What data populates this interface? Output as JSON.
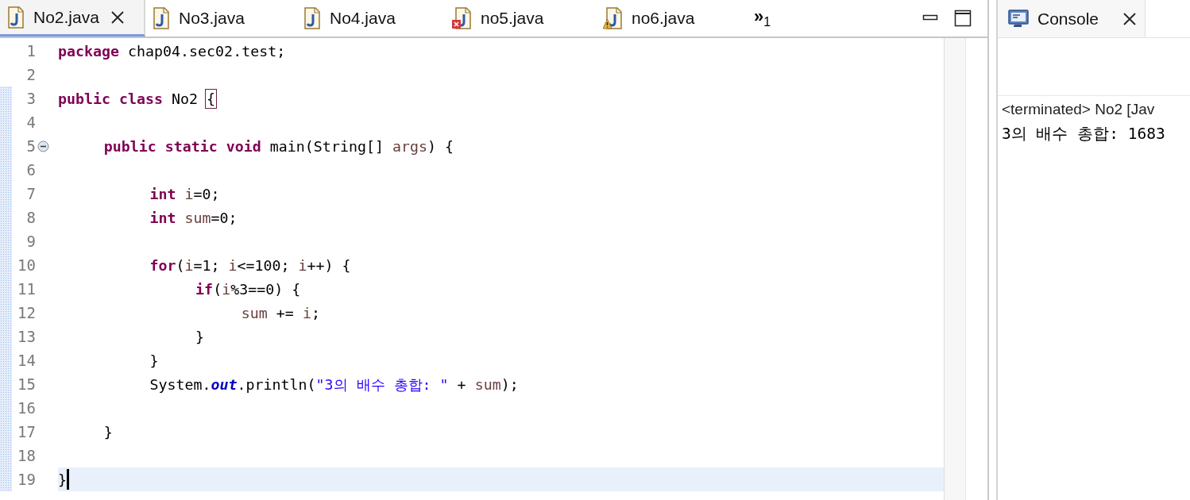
{
  "editor": {
    "tabs": [
      {
        "label": "No2.java",
        "selected": true,
        "error": false,
        "warning": false
      },
      {
        "label": "No3.java",
        "selected": false,
        "error": false,
        "warning": false
      },
      {
        "label": "No4.java",
        "selected": false,
        "error": false,
        "warning": false
      },
      {
        "label": "no5.java",
        "selected": false,
        "error": true,
        "warning": false
      },
      {
        "label": "no6.java",
        "selected": false,
        "error": false,
        "warning": true
      }
    ],
    "overflow": {
      "chevron": "»",
      "count": "1"
    },
    "lines": [
      {
        "number": "1",
        "changed": false,
        "fold_marker": false,
        "current": false,
        "tokens": [
          {
            "kind": "kw",
            "text": "package"
          },
          {
            "kind": "plain",
            "text": " chap04.sec02.test;"
          }
        ]
      },
      {
        "number": "2",
        "changed": false,
        "fold_marker": false,
        "current": false
      },
      {
        "number": "3",
        "changed": true,
        "fold_marker": false,
        "current": false,
        "tokens": [
          {
            "kind": "kw",
            "text": "public class"
          },
          {
            "kind": "plain",
            "text": " No2 "
          },
          {
            "kind": "match",
            "text": "{"
          }
        ]
      },
      {
        "number": "4",
        "changed": true,
        "fold_marker": false,
        "current": false
      },
      {
        "number": "5",
        "changed": true,
        "fold_marker": true,
        "current": false,
        "tokens": [
          {
            "kind": "kw",
            "text": "\tpublic static void"
          },
          {
            "kind": "plain",
            "text": " main(String[] "
          },
          {
            "kind": "var",
            "text": "args"
          },
          {
            "kind": "plain",
            "text": ") {"
          }
        ]
      },
      {
        "number": "6",
        "changed": true,
        "fold_marker": false,
        "current": false
      },
      {
        "number": "7",
        "changed": true,
        "fold_marker": false,
        "current": false,
        "tokens": [
          {
            "kind": "kw",
            "text": "\t\tint "
          },
          {
            "kind": "var",
            "text": "i"
          },
          {
            "kind": "plain",
            "text": "=0;"
          }
        ]
      },
      {
        "number": "8",
        "changed": true,
        "fold_marker": false,
        "current": false,
        "tokens": [
          {
            "kind": "kw",
            "text": "\t\tint "
          },
          {
            "kind": "var",
            "text": "sum"
          },
          {
            "kind": "plain",
            "text": "=0;"
          }
        ]
      },
      {
        "number": "9",
        "changed": true,
        "fold_marker": false,
        "current": false
      },
      {
        "number": "10",
        "changed": true,
        "fold_marker": false,
        "current": false,
        "tokens": [
          {
            "kind": "kw",
            "text": "\t\tfor"
          },
          {
            "kind": "plain",
            "text": "("
          },
          {
            "kind": "var",
            "text": "i"
          },
          {
            "kind": "plain",
            "text": "=1; "
          },
          {
            "kind": "var",
            "text": "i"
          },
          {
            "kind": "plain",
            "text": "<=100; "
          },
          {
            "kind": "var",
            "text": "i"
          },
          {
            "kind": "plain",
            "text": "++) {"
          }
        ]
      },
      {
        "number": "11",
        "changed": true,
        "fold_marker": false,
        "current": false,
        "tokens": [
          {
            "kind": "kw",
            "text": "\t\t\tif"
          },
          {
            "kind": "plain",
            "text": "("
          },
          {
            "kind": "var",
            "text": "i"
          },
          {
            "kind": "plain",
            "text": "%3==0) {"
          }
        ]
      },
      {
        "number": "12",
        "changed": true,
        "fold_marker": false,
        "current": false,
        "tokens": [
          {
            "kind": "var",
            "text": "\t\t\t\tsum"
          },
          {
            "kind": "plain",
            "text": " += "
          },
          {
            "kind": "var",
            "text": "i"
          },
          {
            "kind": "plain",
            "text": ";"
          }
        ]
      },
      {
        "number": "13",
        "changed": true,
        "fold_marker": false,
        "current": false,
        "tokens": [
          {
            "kind": "plain",
            "text": "\t\t\t}"
          }
        ]
      },
      {
        "number": "14",
        "changed": true,
        "fold_marker": false,
        "current": false,
        "tokens": [
          {
            "kind": "plain",
            "text": "\t\t}"
          }
        ]
      },
      {
        "number": "15",
        "changed": true,
        "fold_marker": false,
        "current": false,
        "tokens": [
          {
            "kind": "plain",
            "text": "\t\tSystem."
          },
          {
            "kind": "field",
            "text": "out"
          },
          {
            "kind": "plain",
            "text": ".println("
          },
          {
            "kind": "str",
            "text": "\"3의 배수 총합: \""
          },
          {
            "kind": "plain",
            "text": " + "
          },
          {
            "kind": "var",
            "text": "sum"
          },
          {
            "kind": "plain",
            "text": ");"
          }
        ]
      },
      {
        "number": "16",
        "changed": true,
        "fold_marker": false,
        "current": false
      },
      {
        "number": "17",
        "changed": true,
        "fold_marker": false,
        "current": false,
        "tokens": [
          {
            "kind": "plain",
            "text": "\t}"
          }
        ]
      },
      {
        "number": "18",
        "changed": true,
        "fold_marker": false,
        "current": false
      },
      {
        "number": "19",
        "changed": true,
        "fold_marker": false,
        "current": true,
        "tokens": [
          {
            "kind": "plain",
            "text": "}"
          }
        ]
      }
    ]
  },
  "console": {
    "tab": {
      "label": "Console",
      "selected": true
    },
    "header": "<terminated> No2 [Jav",
    "output": "3의 배수 총합: 1683"
  }
}
